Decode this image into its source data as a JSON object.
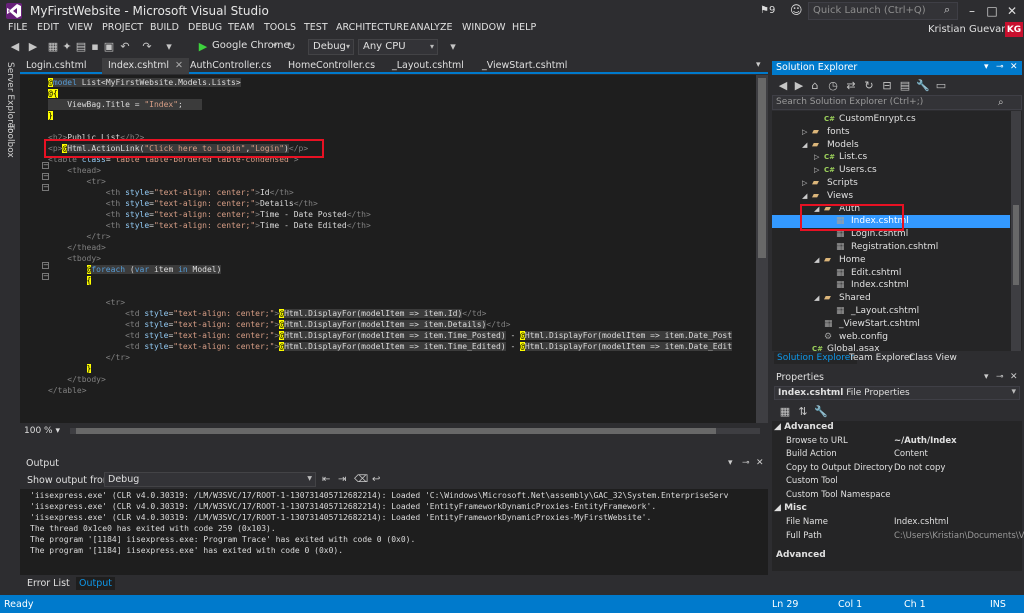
{
  "window": {
    "title": "MyFirstWebsite - Microsoft Visual Studio",
    "notifications": "9",
    "quick_launch_placeholder": "Quick Launch (Ctrl+Q)",
    "user_name": "Kristian Guevara",
    "user_initials": "KG"
  },
  "menu": [
    "FILE",
    "EDIT",
    "VIEW",
    "PROJECT",
    "BUILD",
    "DEBUG",
    "TEAM",
    "TOOLS",
    "TEST",
    "ARCHITECTURE",
    "ANALYZE",
    "WINDOW",
    "HELP"
  ],
  "toolbar": {
    "browser": "Google Chrome",
    "configuration": "Debug",
    "platform": "Any CPU"
  },
  "left_strip": [
    "Server Explorer",
    "Toolbox"
  ],
  "editor_tabs": [
    {
      "label": "Login.cshtml",
      "active": false
    },
    {
      "label": "Index.cshtml",
      "active": true
    },
    {
      "label": "AuthController.cs",
      "active": false
    },
    {
      "label": "HomeController.cs",
      "active": false
    },
    {
      "label": "_Layout.cshtml",
      "active": false
    },
    {
      "label": "_ViewStart.cshtml",
      "active": false
    }
  ],
  "code_lines": [
    "@model List<MyFirstWebsite.Models.Lists>",
    "@{",
    "    ViewBag.Title = \"Index\";",
    "}",
    "",
    "<h2>Public List</h2>",
    "<p>@Html.ActionLink(\"Click here to Login\",\"Login\")</p>",
    "<table class=\"table table-bordered table-condensed\">",
    "    <thead>",
    "        <tr>",
    "            <th style=\"text-align: center;\">Id</th>",
    "            <th style=\"text-align: center;\">Details</th>",
    "            <th style=\"text-align: center;\">Time - Date Posted</th>",
    "            <th style=\"text-align: center;\">Time - Date Edited</th>",
    "        </tr>",
    "    </thead>",
    "    <tbody>",
    "        @foreach (var item in Model)",
    "        {",
    "            <tr>",
    "                <td style=\"text-align: center;\">@Html.DisplayFor(modelItem => item.Id)</td>",
    "                <td style=\"text-align: center;\">@Html.DisplayFor(modelItem => item.Details)</td>",
    "                <td style=\"text-align: center;\">@Html.DisplayFor(modelItem => item.Time_Posted) - @Html.DisplayFor(modelItem => item.Date_Post",
    "                <td style=\"text-align: center;\">@Html.DisplayFor(modelItem => item.Time_Edited) - @Html.DisplayFor(modelItem => item.Date_Edit",
    "            </tr>",
    "        }",
    "    </tbody>",
    "</table>"
  ],
  "zoom": "100 %",
  "output": {
    "title": "Output",
    "show_from_label": "Show output from:",
    "show_from_value": "Debug",
    "lines": [
      "'iisexpress.exe' (CLR v4.0.30319: /LM/W3SVC/17/ROOT-1-130731405712682214): Loaded 'C:\\Windows\\Microsoft.Net\\assembly\\GAC_32\\System.EnterpriseServ",
      "'iisexpress.exe' (CLR v4.0.30319: /LM/W3SVC/17/ROOT-1-130731405712682214): Loaded 'EntityFrameworkDynamicProxies-EntityFramework'.",
      "'iisexpress.exe' (CLR v4.0.30319: /LM/W3SVC/17/ROOT-1-130731405712682214): Loaded 'EntityFrameworkDynamicProxies-MyFirstWebsite'.",
      "The thread 0x1ce0 has exited with code 259 (0x103).",
      "The program '[1184] iisexpress.exe: Program Trace' has exited with code 0 (0x0).",
      "The program '[1184] iisexpress.exe' has exited with code 0 (0x0)."
    ]
  },
  "bottom_tabs": [
    {
      "label": "Error List",
      "active": false
    },
    {
      "label": "Output",
      "active": true
    }
  ],
  "solution_explorer": {
    "title": "Solution Explorer",
    "search_placeholder": "Search Solution Explorer (Ctrl+;)",
    "items": [
      {
        "label": "CustomEnrypt.cs",
        "icon": "cs",
        "level": 3,
        "expand": "none"
      },
      {
        "label": "fonts",
        "icon": "folder",
        "level": 2,
        "expand": "collapsed"
      },
      {
        "label": "Models",
        "icon": "folder",
        "level": 2,
        "expand": "expanded"
      },
      {
        "label": "List.cs",
        "icon": "cs",
        "level": 3,
        "expand": "collapsed"
      },
      {
        "label": "Users.cs",
        "icon": "cs",
        "level": 3,
        "expand": "collapsed"
      },
      {
        "label": "Scripts",
        "icon": "folder",
        "level": 2,
        "expand": "collapsed"
      },
      {
        "label": "Views",
        "icon": "folder",
        "level": 2,
        "expand": "expanded"
      },
      {
        "label": "Auth",
        "icon": "folder",
        "level": 3,
        "expand": "expanded"
      },
      {
        "label": "Index.cshtml",
        "icon": "cshtml",
        "level": 4,
        "expand": "none",
        "selected": true
      },
      {
        "label": "Login.cshtml",
        "icon": "cshtml",
        "level": 4,
        "expand": "none"
      },
      {
        "label": "Registration.cshtml",
        "icon": "cshtml",
        "level": 4,
        "expand": "none"
      },
      {
        "label": "Home",
        "icon": "folder",
        "level": 3,
        "expand": "expanded"
      },
      {
        "label": "Edit.cshtml",
        "icon": "cshtml",
        "level": 4,
        "expand": "none"
      },
      {
        "label": "Index.cshtml",
        "icon": "cshtml",
        "level": 4,
        "expand": "none"
      },
      {
        "label": "Shared",
        "icon": "folder",
        "level": 3,
        "expand": "expanded"
      },
      {
        "label": "_Layout.cshtml",
        "icon": "cshtml",
        "level": 4,
        "expand": "none"
      },
      {
        "label": "_ViewStart.cshtml",
        "icon": "cshtml",
        "level": 3,
        "expand": "none"
      },
      {
        "label": "web.config",
        "icon": "config",
        "level": 3,
        "expand": "none"
      },
      {
        "label": "Global.asax",
        "icon": "cs",
        "level": 2,
        "expand": "none"
      }
    ],
    "tabs": [
      {
        "label": "Solution Explorer",
        "active": true
      },
      {
        "label": "Team Explorer",
        "active": false
      },
      {
        "label": "Class View",
        "active": false
      }
    ]
  },
  "properties": {
    "title": "Properties",
    "object_name": "Index.cshtml",
    "object_type": "File Properties",
    "categories": [
      {
        "name": "Advanced",
        "rows": [
          {
            "key": "Browse to URL",
            "value": "~/Auth/Index",
            "bold": true
          },
          {
            "key": "Build Action",
            "value": "Content"
          },
          {
            "key": "Copy to Output Directory",
            "value": "Do not copy"
          },
          {
            "key": "Custom Tool",
            "value": ""
          },
          {
            "key": "Custom Tool Namespace",
            "value": ""
          }
        ]
      },
      {
        "name": "Misc",
        "rows": [
          {
            "key": "File Name",
            "value": "Index.cshtml"
          },
          {
            "key": "Full Path",
            "value": "C:\\Users\\Kristian\\Documents\\Vis",
            "dim": true
          }
        ]
      }
    ],
    "description_title": "Advanced"
  },
  "status": {
    "ready": "Ready",
    "line": "Ln 29",
    "col": "Col 1",
    "ch": "Ch 1",
    "mode": "INS"
  },
  "colors": {
    "accent": "#007acc",
    "highlight_box": "#e81123",
    "selection": "#3399ff"
  }
}
